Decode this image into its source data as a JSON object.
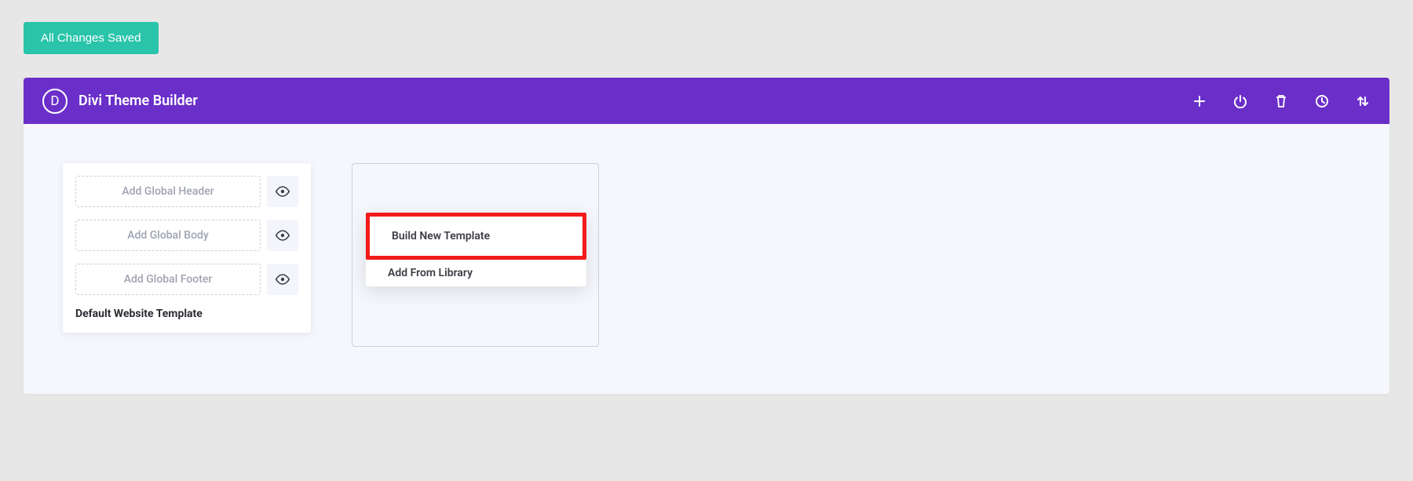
{
  "save_button": {
    "label": "All Changes Saved"
  },
  "header": {
    "logo_letter": "D",
    "title": "Divi Theme Builder"
  },
  "template": {
    "slots": {
      "header": "Add Global Header",
      "body": "Add Global Body",
      "footer": "Add Global Footer"
    },
    "title": "Default Website Template"
  },
  "dropdown": {
    "build_new": "Build New Template",
    "add_from_library": "Add From Library"
  }
}
